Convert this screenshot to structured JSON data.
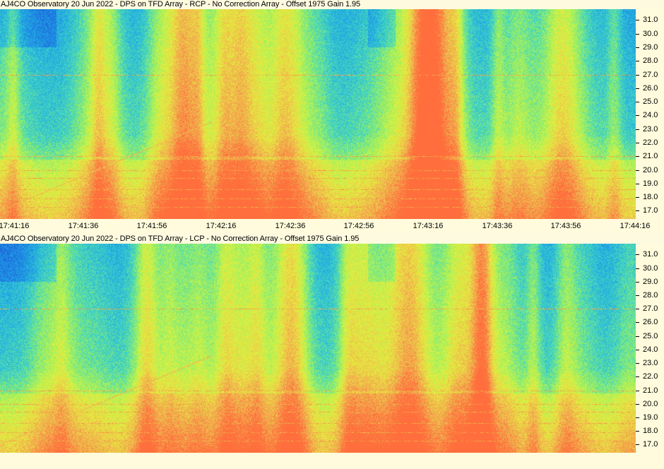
{
  "panels": [
    {
      "title": "AJ4CO Observatory 20 Jun 2022 - DPS on TFD Array  - RCP  -  No Correction Array  -  Offset 1975  Gain 1.95",
      "polarization": "RCP"
    },
    {
      "title": "AJ4CO Observatory 20 Jun 2022 - DPS on TFD Array - LCP  -  No Correction Array  -  Offset 1975  Gain 1.95",
      "polarization": "LCP"
    }
  ],
  "time_labels": [
    "17:41:16",
    "17:41:36",
    "17:41:56",
    "17:42:16",
    "17:42:36",
    "17:42:56",
    "17:43:16",
    "17:43:36",
    "17:43:56",
    "17:44:16"
  ],
  "freq_labels": [
    "31.0",
    "30.0",
    "29.0",
    "28.0",
    "27.0",
    "26.0",
    "25.0",
    "24.0",
    "23.0",
    "22.0",
    "21.0",
    "20.0",
    "19.0",
    "18.0",
    "17.0"
  ],
  "chart_data": [
    {
      "type": "heatmap",
      "title": "AJ4CO Observatory 20 Jun 2022 - DPS on TFD Array  - RCP  -  No Correction Array  -  Offset 1975  Gain 1.95",
      "xlabel": "",
      "ylabel": "",
      "x_ticks": [
        "17:41:16",
        "17:41:36",
        "17:41:56",
        "17:42:16",
        "17:42:36",
        "17:42:56",
        "17:43:16",
        "17:43:36",
        "17:43:56",
        "17:44:16"
      ],
      "y_ticks": [
        31.0,
        30.0,
        29.0,
        28.0,
        27.0,
        26.0,
        25.0,
        24.0,
        23.0,
        22.0,
        21.0,
        20.0,
        19.0,
        18.0,
        17.0
      ],
      "ylim": [
        16.4,
        31.8
      ],
      "colormap": [
        "#0a1e8c",
        "#1e64dc",
        "#1ea0e6",
        "#3cd2c8",
        "#96f064",
        "#e6f03c",
        "#f0b450",
        "#ff6e3c"
      ]
    },
    {
      "type": "heatmap",
      "title": "AJ4CO Observatory 20 Jun 2022 - DPS on TFD Array - LCP  -  No Correction Array  -  Offset 1975  Gain 1.95",
      "xlabel": "",
      "ylabel": "",
      "y_ticks": [
        31.0,
        30.0,
        29.0,
        28.0,
        27.0,
        26.0,
        25.0,
        24.0,
        23.0,
        22.0,
        21.0,
        20.0,
        19.0,
        18.0,
        17.0
      ],
      "ylim": [
        16.4,
        31.8
      ],
      "colormap": [
        "#0a1e8c",
        "#1e64dc",
        "#1ea0e6",
        "#3cd2c8",
        "#96f064",
        "#e6f03c",
        "#f0b450",
        "#ff6e3c"
      ]
    }
  ]
}
